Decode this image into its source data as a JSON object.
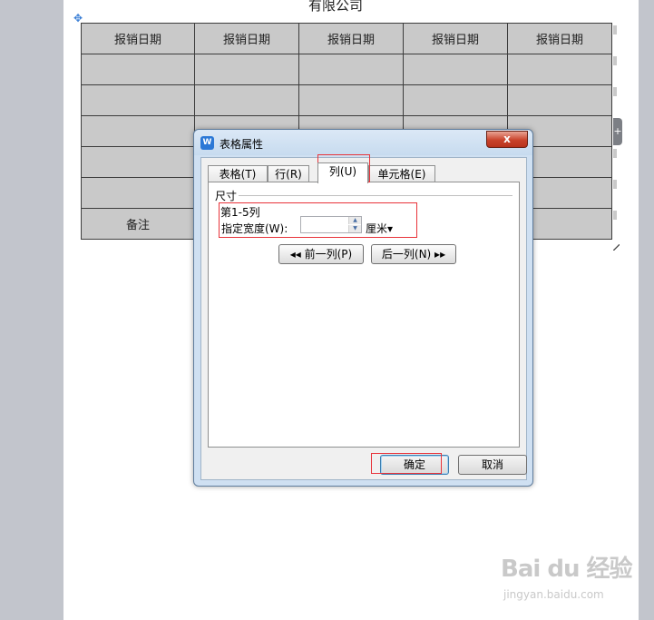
{
  "document": {
    "title": "有限公司",
    "table": {
      "header": [
        "报销日期",
        "报销日期",
        "报销日期",
        "报销日期",
        "报销日期"
      ],
      "rows": [
        [
          "",
          "",
          "",
          "",
          ""
        ],
        [
          "",
          "",
          "",
          "",
          ""
        ],
        [
          "",
          "",
          "",
          "",
          ""
        ],
        [
          "",
          "",
          "",
          "",
          ""
        ],
        [
          "",
          "",
          "",
          "",
          ""
        ],
        [
          "备注",
          "",
          "",
          "",
          ""
        ]
      ]
    },
    "insert_handle": "+",
    "move_handle": "✥"
  },
  "dialog": {
    "title": "表格属性",
    "app_icon": "W",
    "close_label": "x",
    "tabs": [
      "表格(T)",
      "行(R)",
      "列(U)",
      "单元格(E)"
    ],
    "active_tab": "列(U)",
    "group_label": "尺寸",
    "column_range": "第1-5列",
    "width_label": "指定宽度(W):",
    "width_value": "",
    "unit": "厘米▾",
    "prev_col": "◂◂ 前一列(P)",
    "next_col": "后一列(N) ▸▸",
    "ok": "确定",
    "cancel": "取消"
  },
  "watermark": {
    "brand": "Bai du 经验",
    "url": "jingyan.baidu.com"
  },
  "colors": {
    "highlight": "#e8333a",
    "dialog_frame": "#cfe0f2",
    "close": "#c9432b"
  }
}
